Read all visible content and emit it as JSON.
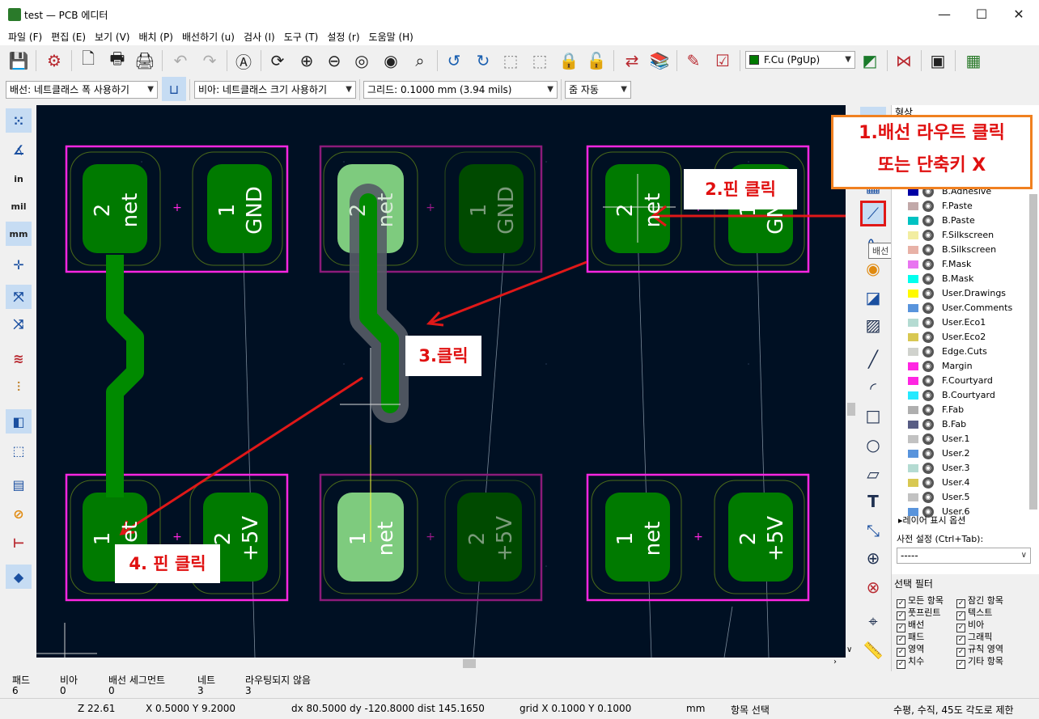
{
  "window": {
    "title": "test — PCB 에디터",
    "minimize": "—",
    "maximize": "☐",
    "close": "✕"
  },
  "menu": [
    "파일 (F)",
    "편집 (E)",
    "보기 (V)",
    "배치 (P)",
    "배선하기 (u)",
    "검사 (I)",
    "도구 (T)",
    "설정 (r)",
    "도움말 (H)"
  ],
  "toolbar2": {
    "track_width": "배선: 네트클래스 폭 사용하기",
    "via_size": "비아: 네트클래스 크기 사용하기",
    "grid": "그리드: 0.1000 mm (3.94 mils)",
    "zoom": "줌 자동"
  },
  "layer_select": "F.Cu (PgUp)",
  "left_toolbar": {
    "inch": "in",
    "mil": "mil",
    "mm": "mm"
  },
  "layers_panel": {
    "header": "형상",
    "layers": [
      {
        "name": "B.Adhesive",
        "color": "#0000a4"
      },
      {
        "name": "F.Paste",
        "color": "#c2a9a9"
      },
      {
        "name": "B.Paste",
        "color": "#00c2c2"
      },
      {
        "name": "F.Silkscreen",
        "color": "#f2eda1"
      },
      {
        "name": "B.Silkscreen",
        "color": "#e8b2a7"
      },
      {
        "name": "F.Mask",
        "color": "#e875f0"
      },
      {
        "name": "B.Mask",
        "color": "#02ffee"
      },
      {
        "name": "User.Drawings",
        "color": "#fffa00"
      },
      {
        "name": "User.Comments",
        "color": "#5994dc"
      },
      {
        "name": "User.Eco1",
        "color": "#b4dbd2"
      },
      {
        "name": "User.Eco2",
        "color": "#d8c852"
      },
      {
        "name": "Edge.Cuts",
        "color": "#d0d2cd"
      },
      {
        "name": "Margin",
        "color": "#ff26e2"
      },
      {
        "name": "F.Courtyard",
        "color": "#ff26e2"
      },
      {
        "name": "B.Courtyard",
        "color": "#26e9ff"
      },
      {
        "name": "F.Fab",
        "color": "#afafaf"
      },
      {
        "name": "B.Fab",
        "color": "#585d84"
      },
      {
        "name": "User.1",
        "color": "#c2c2c2"
      },
      {
        "name": "User.2",
        "color": "#5994dc"
      },
      {
        "name": "User.3",
        "color": "#b4dbd2"
      },
      {
        "name": "User.4",
        "color": "#d8c852"
      },
      {
        "name": "User.5",
        "color": "#c2c2c2"
      },
      {
        "name": "User.6",
        "color": "#5994dc"
      }
    ],
    "display_options": "▸레이어 표시 옵션",
    "preset_label": "사전 설정 (Ctrl+Tab):",
    "preset_value": "-----"
  },
  "selection_filter": {
    "title": "선택 필터",
    "items": [
      "모든 항목",
      "잠긴 항목",
      "풋프린트",
      "텍스트",
      "배선",
      "비아",
      "패드",
      "그래픽",
      "영역",
      "규칙 영역",
      "치수",
      "기타 항목"
    ]
  },
  "tooltip": "배선 라우트  (X)",
  "pcb": {
    "footprints": [
      {
        "pin_left": "2",
        "net_left": "net",
        "pin_right": "1",
        "net_right": "GND"
      },
      {
        "pin_left": "2",
        "net_left": "net",
        "pin_right": "1",
        "net_right": "GND"
      },
      {
        "pin_left": "2",
        "net_left": "net",
        "pin_right": "1",
        "net_right": "GND"
      },
      {
        "pin_left": "1",
        "net_left": "net",
        "pin_right": "2",
        "net_right": "+5V"
      },
      {
        "pin_left": "1",
        "net_left": "net",
        "pin_right": "2",
        "net_right": "+5V"
      },
      {
        "pin_left": "1",
        "net_left": "net",
        "pin_right": "2",
        "net_right": "+5V"
      }
    ]
  },
  "annotations": {
    "a1_line1": "1.배선 라우트 클릭",
    "a1_line2": "또는 단축키 X",
    "a2": "2.핀 클릭",
    "a3": "3.클릭",
    "a4": "4. 핀 클릭"
  },
  "message_panel": [
    {
      "label": "패드",
      "value": "6"
    },
    {
      "label": "비아",
      "value": "0"
    },
    {
      "label": "배선 세그먼트",
      "value": "0"
    },
    {
      "label": "네트",
      "value": "3"
    },
    {
      "label": "라우팅되지 않음",
      "value": "3"
    }
  ],
  "status": {
    "zoom": "Z 22.61",
    "xy": "X 0.5000  Y 9.2000",
    "delta": "dx 80.5000  dy -120.8000  dist 145.1650",
    "grid": "grid X 0.1000  Y 0.1000",
    "units": "mm",
    "mode": "항목 선택",
    "constraint": "수평, 수직, 45도 각도로 제한"
  }
}
